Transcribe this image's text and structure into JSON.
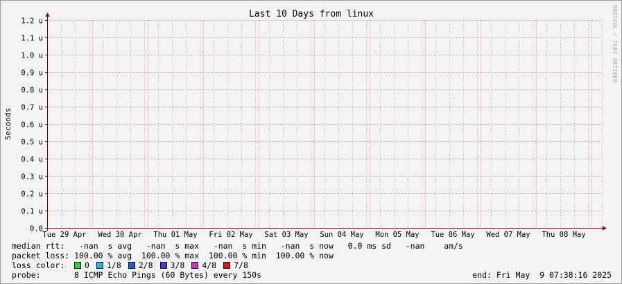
{
  "chart_data": {
    "type": "line",
    "title": "Last 10 Days from linux",
    "ylabel": "Seconds",
    "xlabel": "",
    "ylim": [
      0,
      1.2
    ],
    "y_ticks": [
      "0.0",
      "0.1 u",
      "0.2 u",
      "0.3 u",
      "0.4 u",
      "0.5 u",
      "0.6 u",
      "0.7 u",
      "0.8 u",
      "0.9 u",
      "1.0 u",
      "1.1 u",
      "1.2 u"
    ],
    "categories": [
      "Tue 29 Apr",
      "Wed 30 Apr",
      "Thu 01 May",
      "Fri 02 May",
      "Sat 03 May",
      "Sun 04 May",
      "Mon 05 May",
      "Tue 06 May",
      "Wed 07 May",
      "Thu 08 May"
    ],
    "series": [],
    "grid": true,
    "grid_color": "#e8a3a3",
    "axis_color": "#8b0000"
  },
  "watermark": "RRDTOOL / TOBI OETIKER",
  "legend": {
    "median_rtt": "median rtt:   -nan  s avg   -nan  s max   -nan  s min   -nan  s now   0.0 ms sd   -nan    am/s",
    "packet_loss": "packet loss: 100.00 % avg  100.00 % max  100.00 % min  100.00 % now",
    "loss_color_label": "loss color:",
    "loss_colors": [
      {
        "label": "0",
        "color": "#22dd22"
      },
      {
        "label": "1/8",
        "color": "#11bbee"
      },
      {
        "label": "2/8",
        "color": "#1a5fdd"
      },
      {
        "label": "3/8",
        "color": "#6a2bd8"
      },
      {
        "label": "4/8",
        "color": "#cc2bd8"
      },
      {
        "label": "7/8",
        "color": "#e01010"
      }
    ],
    "probe": "probe:       8 ICMP Echo Pings (60 Bytes) every 150s",
    "end": "end: Fri May  9 07:38:16 2025"
  }
}
